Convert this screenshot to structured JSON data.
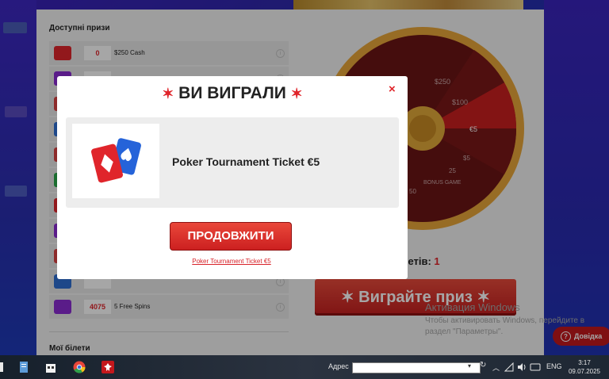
{
  "prizes": {
    "title": "Доступні призи",
    "items": [
      {
        "count": "0",
        "name": "$250 Cash",
        "color": "#e0252b"
      },
      {
        "count": "",
        "name": "",
        "color": "#8a2bd3"
      },
      {
        "count": "",
        "name": "",
        "color": "#d94141"
      },
      {
        "count": "",
        "name": "",
        "color": "#2f6fd3"
      },
      {
        "count": "",
        "name": "",
        "color": "#d94141"
      },
      {
        "count": "",
        "name": "",
        "color": "#2aa84a"
      },
      {
        "count": "",
        "name": "",
        "color": "#e0252b"
      },
      {
        "count": "",
        "name": "",
        "color": "#8a2bd3"
      },
      {
        "count": "",
        "name": "",
        "color": "#d94141"
      },
      {
        "count": "",
        "name": "",
        "color": "#2f6fd3"
      },
      {
        "count": "4075",
        "name": "5 Free Spins",
        "color": "#8a2bd3"
      }
    ]
  },
  "tickets": {
    "title": "Мої білети"
  },
  "wheel": {
    "segments": [
      "$250",
      "$100",
      "€5",
      "$5",
      "25",
      "BONUS GAME",
      "50"
    ],
    "colors": {
      "segment_dark": "#6b1414",
      "segment_red": "#c91f1f",
      "rim": "#e8a63a",
      "hub": "#e2a93a"
    }
  },
  "ticket_count": {
    "label": "ю білетів: ",
    "value": "1"
  },
  "play_button": {
    "label": "✶ Виграйте приз ✶"
  },
  "modal": {
    "title": "ВИ ВИГРАЛИ",
    "prize_name": "Poker Tournament Ticket €5",
    "continue_label": "ПРОДОВЖИТИ",
    "link_label": "Poker Tournament Ticket €5",
    "close_symbol": "×"
  },
  "windows_watermark": {
    "line1": "Активация Windows",
    "line2": "Чтобы активировать Windows, перейдите в раздел \"Параметры\"."
  },
  "help_button": {
    "label": "Довідка"
  },
  "taskbar": {
    "address_label": "Адрес",
    "address_value": "",
    "language": "ENG",
    "time": "3:17",
    "date": "09.07.2025"
  },
  "theme": {
    "accent": "#e0252b",
    "button_red": "#cc2020"
  }
}
